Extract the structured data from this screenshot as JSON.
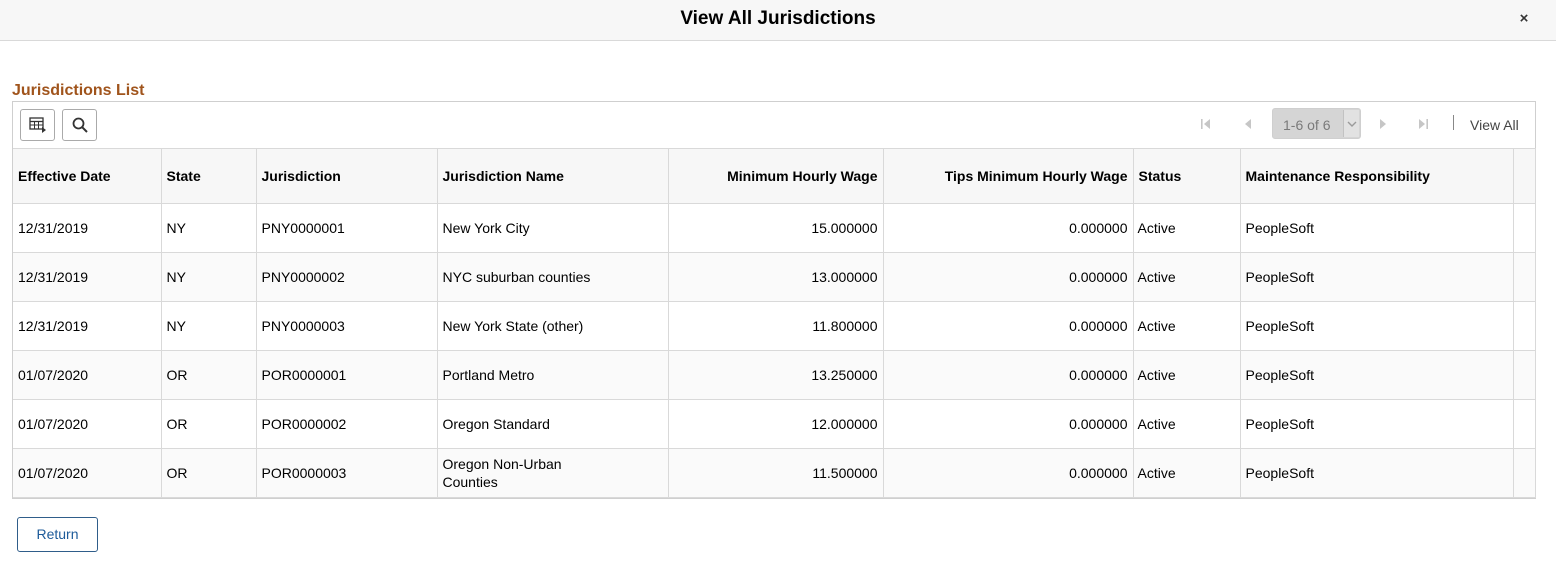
{
  "dialog": {
    "title": "View All Jurisdictions",
    "close_label": "×"
  },
  "grid": {
    "title": "Jurisdictions List",
    "pagination": {
      "range": "1-6 of 6",
      "view_all": "View All"
    },
    "columns": [
      "Effective Date",
      "State",
      "Jurisdiction",
      "Jurisdiction Name",
      "Minimum Hourly Wage",
      "Tips Minimum Hourly Wage",
      "Status",
      "Maintenance Responsibility"
    ],
    "rows": [
      {
        "effective_date": "12/31/2019",
        "state": "NY",
        "jurisdiction": "PNY0000001",
        "name": "New York City",
        "min_wage": "15.000000",
        "tips_min_wage": "0.000000",
        "status": "Active",
        "maintenance": "PeopleSoft"
      },
      {
        "effective_date": "12/31/2019",
        "state": "NY",
        "jurisdiction": "PNY0000002",
        "name": "NYC suburban counties",
        "min_wage": "13.000000",
        "tips_min_wage": "0.000000",
        "status": "Active",
        "maintenance": "PeopleSoft"
      },
      {
        "effective_date": "12/31/2019",
        "state": "NY",
        "jurisdiction": "PNY0000003",
        "name": "New York State (other)",
        "min_wage": "11.800000",
        "tips_min_wage": "0.000000",
        "status": "Active",
        "maintenance": "PeopleSoft"
      },
      {
        "effective_date": "01/07/2020",
        "state": "OR",
        "jurisdiction": "POR0000001",
        "name": "Portland Metro",
        "min_wage": "13.250000",
        "tips_min_wage": "0.000000",
        "status": "Active",
        "maintenance": "PeopleSoft"
      },
      {
        "effective_date": "01/07/2020",
        "state": "OR",
        "jurisdiction": "POR0000002",
        "name": "Oregon Standard",
        "min_wage": "12.000000",
        "tips_min_wage": "0.000000",
        "status": "Active",
        "maintenance": "PeopleSoft"
      },
      {
        "effective_date": "01/07/2020",
        "state": "OR",
        "jurisdiction": "POR0000003",
        "name": "Oregon Non-Urban Counties",
        "min_wage": "11.500000",
        "tips_min_wage": "0.000000",
        "status": "Active",
        "maintenance": "PeopleSoft"
      }
    ]
  },
  "footer": {
    "return_label": "Return"
  },
  "colors": {
    "section_title": "#a0541c",
    "button_text": "#1d5b9a",
    "header_bg": "#f7f7f7"
  },
  "icons": [
    "close-icon",
    "personalize-grid-icon",
    "search-icon",
    "first-page-icon",
    "previous-page-icon",
    "chevron-down-icon",
    "next-page-icon",
    "last-page-icon"
  ]
}
